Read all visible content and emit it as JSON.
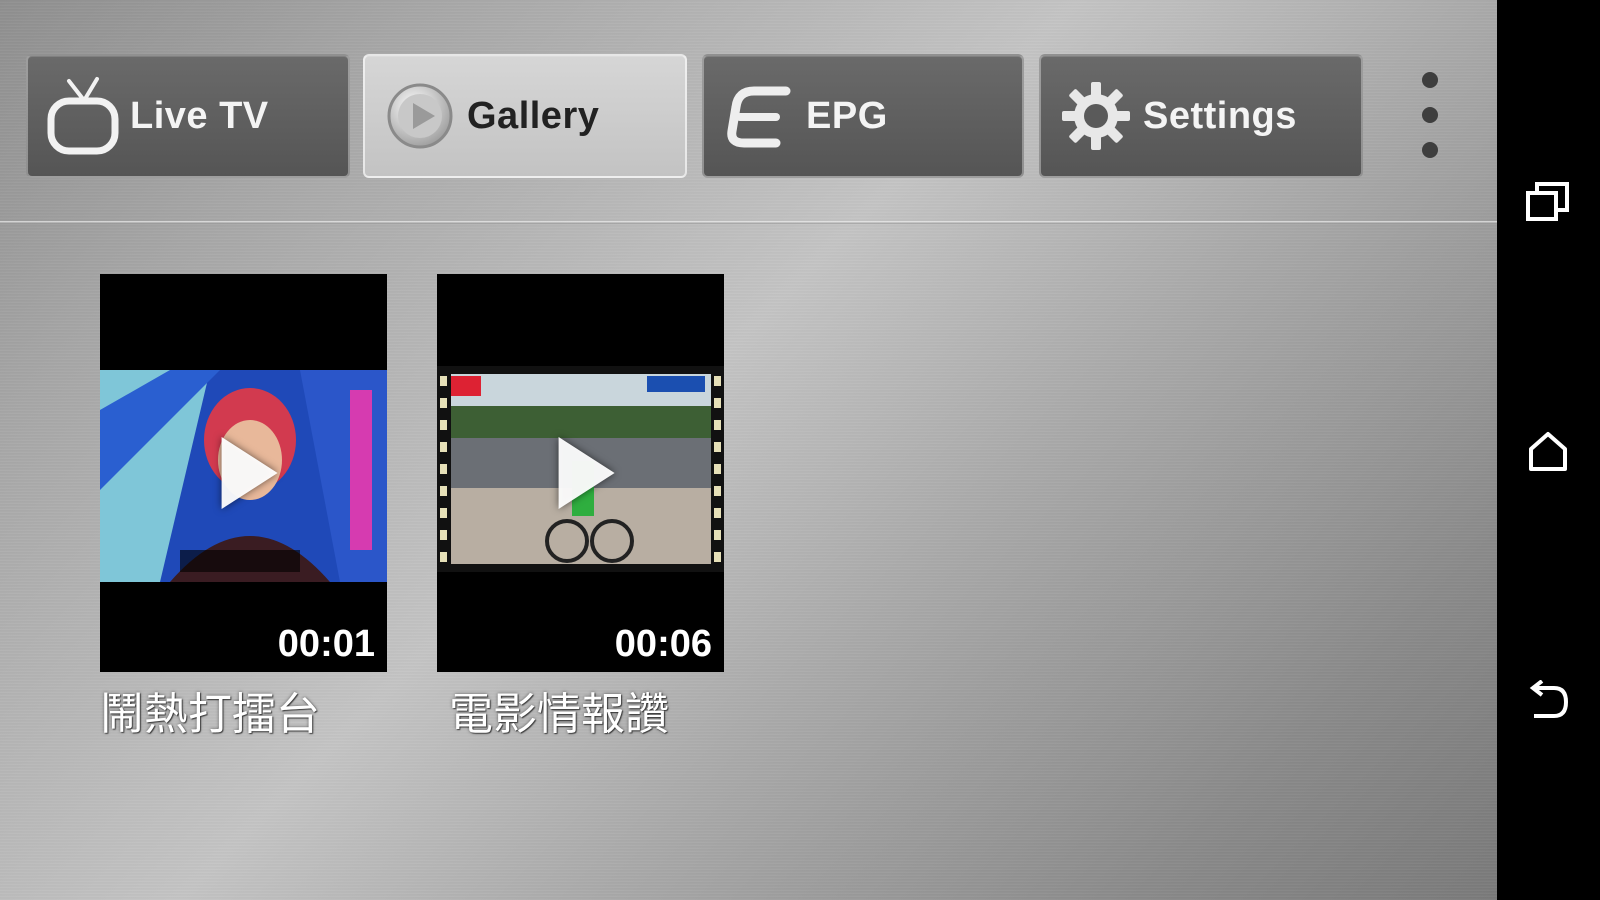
{
  "tabs": [
    {
      "label": "Live TV",
      "icon": "tv-icon",
      "active": false
    },
    {
      "label": "Gallery",
      "icon": "play-circle-icon",
      "active": true
    },
    {
      "label": "EPG",
      "icon": "epg-logo-icon",
      "active": false
    },
    {
      "label": "Settings",
      "icon": "gear-icon",
      "active": false
    }
  ],
  "overflow_menu": {
    "icon": "more-vertical-icon"
  },
  "videos": [
    {
      "title": "鬧熱打擂台",
      "duration": "00:01"
    },
    {
      "title": "電影情報讚",
      "duration": "00:06"
    }
  ],
  "navigation_bar": {
    "buttons": [
      {
        "icon": "recents-icon"
      },
      {
        "icon": "home-icon"
      },
      {
        "icon": "back-icon"
      }
    ]
  },
  "colors": {
    "tab_inactive": "#5e5e5e",
    "tab_active": "#cdcdcd",
    "nav_background": "#000000"
  }
}
